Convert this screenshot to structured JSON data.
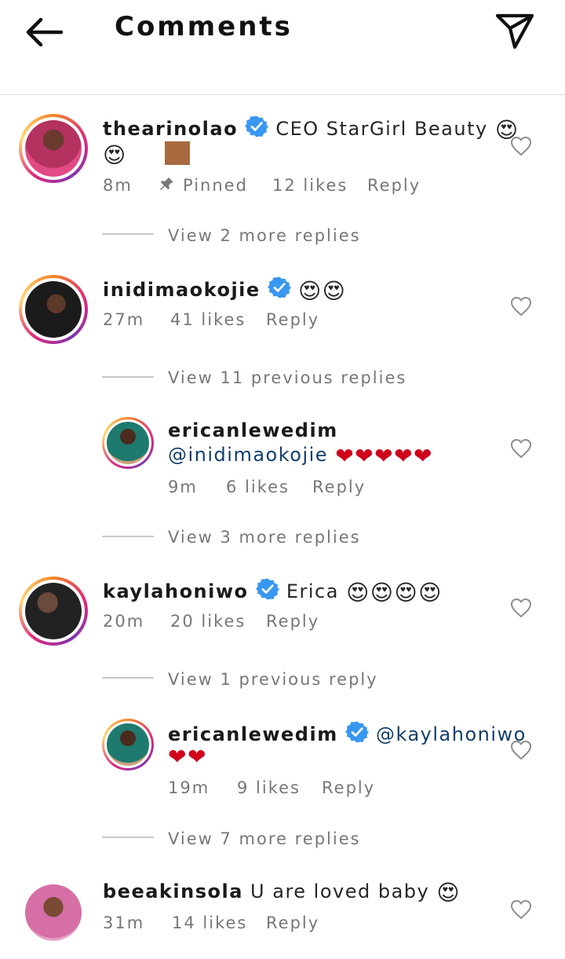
{
  "header": {
    "title": "Comments"
  },
  "comments": [
    {
      "username": "thearinolao",
      "text": "CEO StarGirl Beauty",
      "time": "8m",
      "pinned": "Pinned",
      "likes": "12 likes",
      "reply": "Reply",
      "view": "View 2 more replies"
    },
    {
      "username": "inidimaokojie",
      "time": "27m",
      "likes": "41 likes",
      "reply": "Reply",
      "view": "View 11 previous replies"
    },
    {
      "username": "ericanlewedim",
      "mention": "@inidimaokojie",
      "time": "9m",
      "likes": "6 likes",
      "reply": "Reply",
      "view": "View 3 more replies"
    },
    {
      "username": "kaylahoniwo",
      "text": "Erica",
      "time": "20m",
      "likes": "20 likes",
      "reply": "Reply",
      "view": "View 1 previous reply"
    },
    {
      "username": "ericanlewedim",
      "mention": "@kaylahoniwo",
      "time": "19m",
      "likes": "9 likes",
      "reply": "Reply",
      "view": "View 7 more replies"
    },
    {
      "username": "beeakinsola",
      "text": "U are loved baby",
      "time": "31m",
      "likes": "14 likes",
      "reply": "Reply"
    }
  ],
  "colors": {
    "verified": "#3897f0",
    "mention": "#133e6b",
    "meta": "#777777"
  },
  "icons": [
    "back-arrow-icon",
    "send-icon",
    "verified-icon",
    "heart-outline-icon",
    "pin-icon"
  ]
}
